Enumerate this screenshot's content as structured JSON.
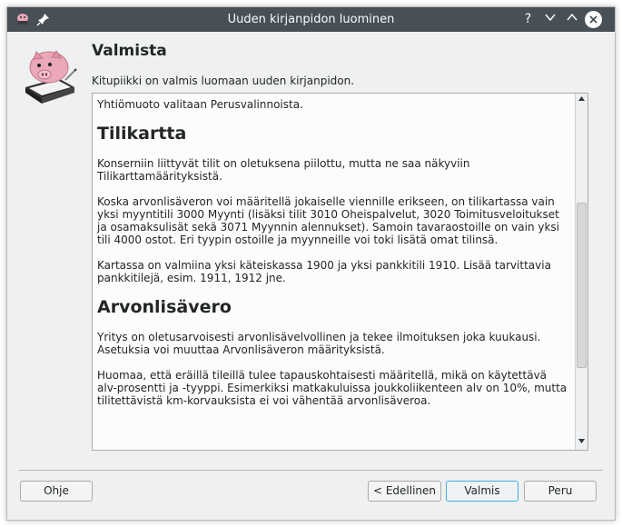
{
  "window": {
    "title": "Uuden kirjanpidon luominen",
    "controls": {
      "help": "?",
      "minimize": "⌄",
      "maximize": "⌃",
      "close": "✕"
    }
  },
  "header": {
    "title": "Valmista",
    "subtitle": "Kitupiikki on valmis luomaan uuden kirjanpidon."
  },
  "content": {
    "intro": "Yhtiömuoto valitaan Perusvalinnoista.",
    "sections": [
      {
        "heading": "Tilikartta",
        "paragraphs": [
          "Konserniin liittyvät tilit on oletuksena piilottu, mutta ne saa näkyviin Tilikarttamäärityksistä.",
          "Koska arvonlisäveron voi määritellä jokaiselle viennille erikseen, on tilikartassa vain yksi myyntitili 3000 Myynti (lisäksi tilit 3010 Oheispalvelut, 3020 Toimitusveloitukset ja osamaksulisät sekä 3071 Myynnin alennukset). Samoin tavaraostoille on vain yksi tili 4000 ostot. Eri tyypin ostoille ja myynneille voi toki lisätä omat tilinsä.",
          "Kartassa on valmiina yksi käteiskassa 1900 ja yksi pankkitili 1910. Lisää tarvittavia pankkitilejä, esim. 1911, 1912 jne."
        ]
      },
      {
        "heading": "Arvonlisävero",
        "paragraphs": [
          "Yritys on oletusarvoisesti arvonlisävelvollinen ja tekee ilmoituksen joka kuukausi. Asetuksia voi muuttaa Arvonlisäveron määrityksistä.",
          "Huomaa, että eräillä tileillä tulee tapauskohtaisesti määritellä, mikä on käytettävä alv-prosentti ja -tyyppi. Esimerkiksi matkakuluissa joukkoliikenteen alv on 10%, mutta tilitettävistä km-korvauksista ei voi vähentää arvonlisäveroa."
        ]
      }
    ]
  },
  "buttons": {
    "help": "Ohje",
    "back": "< Edellinen",
    "finish": "Valmis",
    "cancel": "Peru"
  },
  "colors": {
    "titlebar": "#475057",
    "focus": "#3daee9",
    "background": "#eff0f1"
  }
}
